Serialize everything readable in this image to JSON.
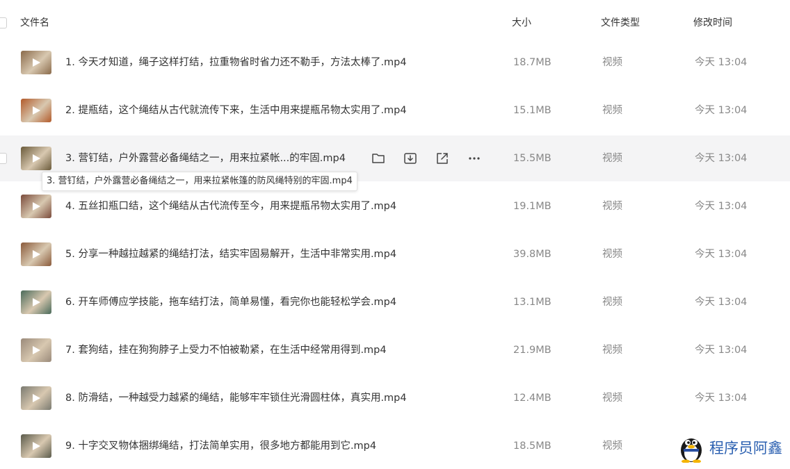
{
  "columns": {
    "name": "文件名",
    "size": "大小",
    "type": "文件类型",
    "modified": "修改时间"
  },
  "files": [
    {
      "name": "1. 今天才知道，绳子这样打结，拉重物省时省力还不勒手，方法太棒了.mp4",
      "size": "18.7MB",
      "type": "视频",
      "modified": "今天 13:04",
      "thumb_color": "#8a6a4a"
    },
    {
      "name": "2. 提瓶结，这个绳结从古代就流传下来，生活中用来提瓶吊物太实用了.mp4",
      "size": "15.1MB",
      "type": "视频",
      "modified": "今天 13:04",
      "thumb_color": "#b25a2a"
    },
    {
      "name": "3. 营钉结，户外露营必备绳结之一，用来拉紧帐...的牢固.mp4",
      "size": "15.5MB",
      "type": "视频",
      "modified": "今天 13:04",
      "thumb_color": "#6a5a3a"
    },
    {
      "name": "4. 五丝扣瓶口结，这个绳结从古代流传至今，用来提瓶吊物太实用了.mp4",
      "size": "19.1MB",
      "type": "视频",
      "modified": "今天 13:04",
      "thumb_color": "#7a4a3a"
    },
    {
      "name": "5. 分享一种越拉越紧的绳结打法，结实牢固易解开，生活中非常实用.mp4",
      "size": "39.8MB",
      "type": "视频",
      "modified": "今天 13:04",
      "thumb_color": "#8a5a3a"
    },
    {
      "name": "6. 开车师傅应学技能，拖车结打法，简单易懂，看完你也能轻松学会.mp4",
      "size": "13.1MB",
      "type": "视频",
      "modified": "今天 13:04",
      "thumb_color": "#4a6a5a"
    },
    {
      "name": "7. 套狗结，挂在狗狗脖子上受力不怕被勒紧，在生活中经常用得到.mp4",
      "size": "21.9MB",
      "type": "视频",
      "modified": "今天 13:04",
      "thumb_color": "#9a8a7a"
    },
    {
      "name": "8. 防滑结，一种越受力越紧的绳结，能够牢牢锁住光滑圆柱体，真实用.mp4",
      "size": "12.4MB",
      "type": "视频",
      "modified": "今天 13:04",
      "thumb_color": "#7a7a70"
    },
    {
      "name": "9. 十字交叉物体捆绑绳结，打法简单实用，很多地方都能用到它.mp4",
      "size": "18.5MB",
      "type": "视频",
      "modified": "",
      "thumb_color": "#5a5a4a"
    }
  ],
  "hovered_row": 2,
  "tooltip": "3. 营钉结，户外露营必备绳结之一，用来拉紧帐篷的防风绳特别的牢固.mp4",
  "row_actions": [
    "folder-icon",
    "download-icon",
    "share-icon",
    "more-icon"
  ],
  "watermark": {
    "text": "程序员阿鑫"
  }
}
